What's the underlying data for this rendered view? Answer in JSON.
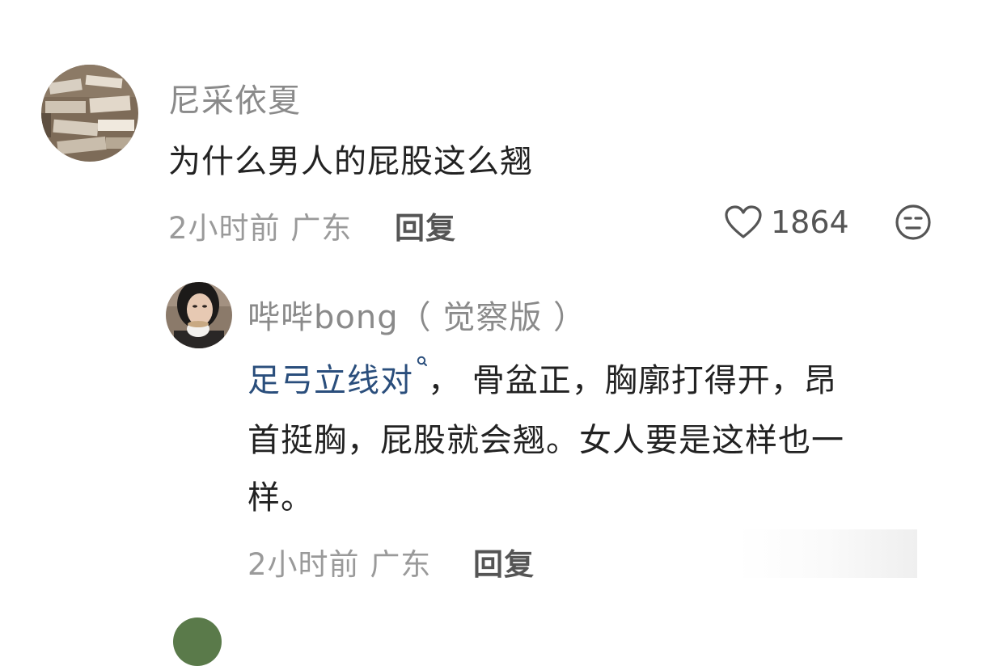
{
  "comments": [
    {
      "username": "尼采依夏",
      "text": "为什么男人的屁股这么翘",
      "time": "2小时前",
      "location": "广东",
      "reply_label": "回复",
      "like_count": "1864",
      "icons": {
        "like": "heart-outline-icon",
        "emoji": "face-emoji-icon",
        "avatar": "books-photo-avatar"
      }
    }
  ],
  "replies": [
    {
      "username": "哔哔bong（ 觉察版 ）",
      "link_text": "足弓立线对",
      "text_line1_rest": "，  骨盆正，胸廓打得开，昂",
      "text_line2": "首挺胸，屁股就会翘。女人要是这样也一",
      "text_line3": "样。",
      "time": "2小时前",
      "location": "广东",
      "reply_label": "回复",
      "icons": {
        "link_search": "search-icon",
        "avatar": "woman-drinking-coffee-avatar"
      }
    }
  ],
  "colors": {
    "username": "#8a8a8a",
    "content": "#222222",
    "meta": "#9a9a9a",
    "link": "#2a4e7c"
  }
}
